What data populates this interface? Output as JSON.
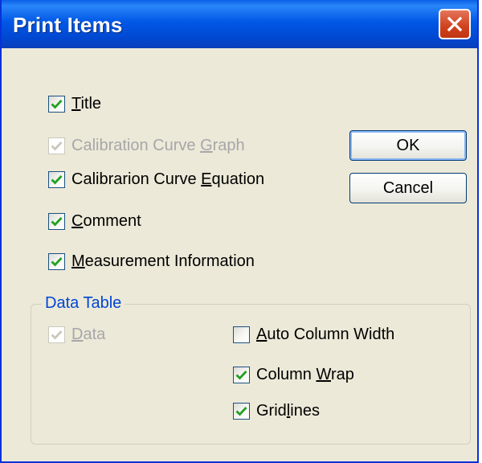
{
  "window": {
    "title": "Print Items"
  },
  "icons": {
    "close": "close-x-icon",
    "check": "checkmark-icon"
  },
  "colors": {
    "title_bar": "#0058e6",
    "close_button": "#d0411d",
    "dialog_bg": "#ece9d8",
    "check_mark": "#21a121",
    "group_label": "#0046d5"
  },
  "options": [
    {
      "label": "Title",
      "mnemonic": "T",
      "checked": true,
      "enabled": true
    },
    {
      "label": "Calibration Curve Graph",
      "mnemonic": "G",
      "checked": true,
      "enabled": false
    },
    {
      "label": "Calibrarion Curve Equation",
      "mnemonic": "E",
      "checked": true,
      "enabled": true
    },
    {
      "label": "Comment",
      "mnemonic": "C",
      "checked": true,
      "enabled": true
    },
    {
      "label": "Measurement Information",
      "mnemonic": "M",
      "checked": true,
      "enabled": true
    }
  ],
  "buttons": {
    "ok": "OK",
    "cancel": "Cancel"
  },
  "data_table": {
    "label": "Data Table",
    "options": [
      {
        "label": "Data",
        "mnemonic": "D",
        "checked": true,
        "enabled": false
      },
      {
        "label": "Auto Column Width",
        "mnemonic": "A",
        "checked": false,
        "enabled": true
      },
      {
        "label": "Column Wrap",
        "mnemonic": "W",
        "checked": true,
        "enabled": true
      },
      {
        "label": "Gridlines",
        "mnemonic": "l",
        "checked": true,
        "enabled": true
      }
    ]
  }
}
